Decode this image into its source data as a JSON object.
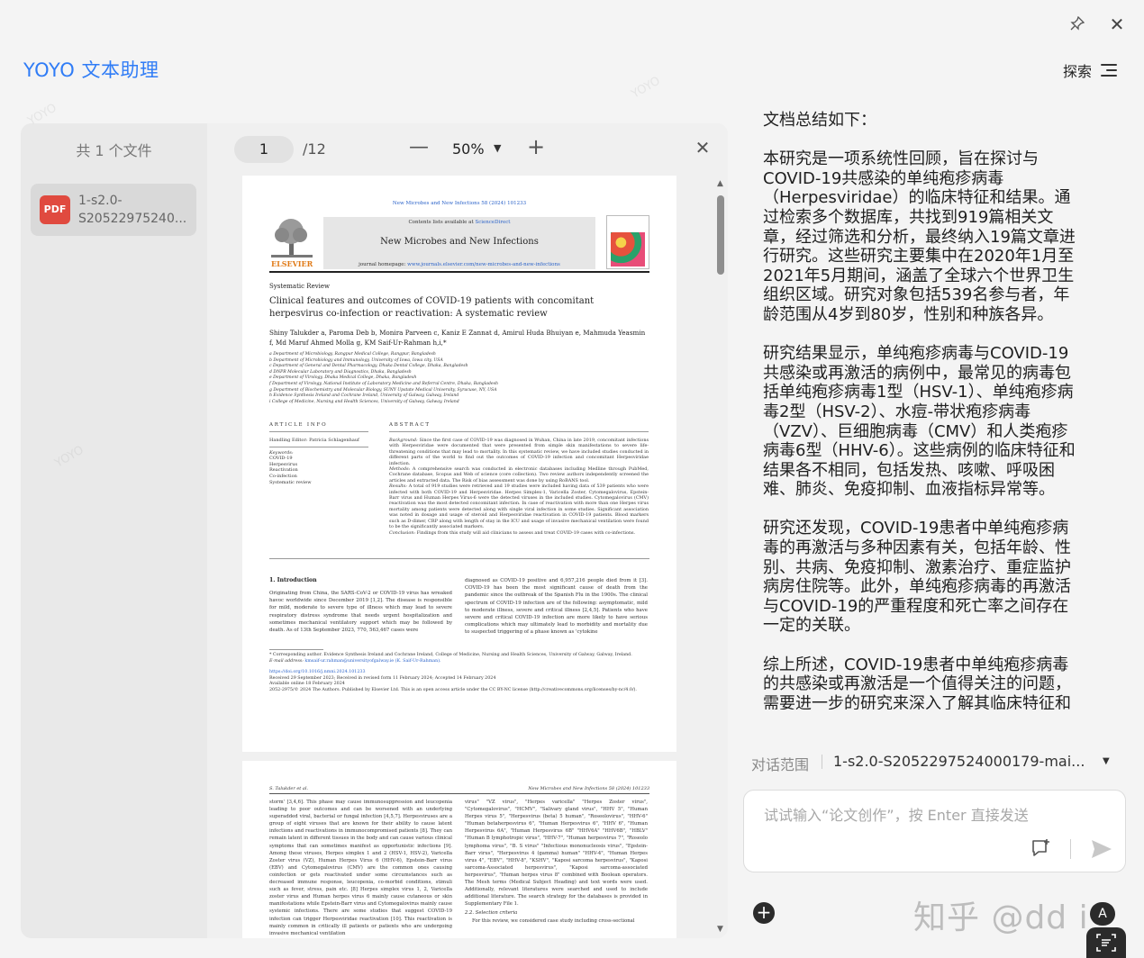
{
  "app": {
    "title": "YOYO 文本助理",
    "explore_label": "探索",
    "pin_icon": "pin-icon",
    "close_icon": "close-icon",
    "menu_icon": "menu-lines-icon"
  },
  "files": {
    "count_label": "共 1 个文件",
    "items": [
      {
        "type": "PDF",
        "name_line1": "1-s2.0-",
        "name_line2": "S20522975240..."
      }
    ]
  },
  "viewer": {
    "current_page": "1",
    "total_pages": "/12",
    "zoom_minus": "—",
    "zoom": "50%",
    "zoom_caret": "▼",
    "zoom_plus": "+",
    "close": "✕",
    "scroll_up": "▲",
    "scroll_down": "▼"
  },
  "paper": {
    "journal_top": "New Microbes and New Infections 58 (2024) 101233",
    "contents_prefix": "Contents lists available at ",
    "contents_link": "ScienceDirect",
    "journal_name": "New Microbes and New Infections",
    "homepage_prefix": "journal homepage: ",
    "homepage_link": "www.journals.elsevier.com/new-microbes-and-new-infections",
    "publisher": "ELSEVIER",
    "section_type": "Systematic Review",
    "title": "Clinical features and outcomes of COVID-19 patients with concomitant herpesvirus co-infection or reactivation: A systematic review",
    "authors": "Shiny Talukder a, Paroma Deb b, Monira Parveen c, Kaniz E Zannat d, Amirul Huda Bhuiyan e, Mahmuda Yeasmin f, Md Maruf Ahmed Molla g, KM Saif-Ur-Rahman h,i,*",
    "affiliations": [
      "a Department of Microbiology, Rangpur Medical College, Rangpur, Bangladesh",
      "b Department of Microbiology and Immunology, University of Iowa, Iowa city, USA",
      "c Department of General and Dental Pharmacology, Dhaka Dental College, Dhaka, Bangladesh",
      "d DNPR Molecular Laboratory and Diagnostics, Dhaka, Bangladesh",
      "e Department of Virology, Dhaka Medical College, Dhaka, Bangladesh",
      "f Department of Virology, National Institute of Laboratory Medicine and Referral Centre, Dhaka, Bangladesh",
      "g Department of Biochemistry and Molecular Biology, SUNY Upstate Medical University, Syracuse, NY, USA",
      "h Evidence Synthesis Ireland and Cochrane Ireland, University of Galway, Galway, Ireland",
      "i College of Medicine, Nursing and Health Sciences, University of Galway, Galway, Ireland"
    ],
    "article_info_head": "ARTICLE INFO",
    "abstract_head": "ABSTRACT",
    "handling_editor": "Handling Editor: Patricia Schlagenhauf",
    "keywords_label": "Keywords:",
    "keywords": [
      "COVID-19",
      "Herpesvirus",
      "Reactivation",
      "Co-infection",
      "Systematic review"
    ],
    "abstract_background_label": "Background:",
    "abstract_background": "Since the first case of COVID-19 was diagnosed in Wuhan, China in late 2019, concomitant infections with Herpesviridae were documented that were presented from simple skin manifestations to severe life-threatening conditions that may lead to mortality. In this systematic review, we have included studies conducted in different parts of the world to find out the outcomes of COVID-19 infection and concomitant Herpesviridae infection.",
    "abstract_methods_label": "Methods:",
    "abstract_methods": "A comprehensive search was conducted in electronic databases including Medline through PubMed, Cochrane database, Scopus and Web of science (core collection). Two review authors independently screened the articles and extracted data. The Risk of bias assessment was done by using RoBANS tool.",
    "abstract_results_label": "Results:",
    "abstract_results": "A total of 919 studies were retrieved and 19 studies were included having data of 539 patients who were infected with both COVID-19 and Herpesviridae. Herpes Simplex-1, Varicella Zoster, Cytomegalovirus, Epstein-Barr virus and Human Herpes Virus-6 were the detected viruses in the included studies. Cytomegalovirus (CMV) reactivation was the most detected concomitant infection. In case of reactivation with more than one Herpes virus mortality among patients were detected along with single viral infection in some studies. Significant association was noted in dosage and usage of steroid and Herpesviridae reactivation in COVID-19 patients. Blood markers such as D-dimer, CRP along with length of stay in the ICU and usage of invasive mechanical ventilation were found to be the significantly associated markers.",
    "abstract_conclusion_label": "Conclusion:",
    "abstract_conclusion": "Findings from this study will aid clinicians to assess and treat COVID-19 cases with co-infections.",
    "intro_head": "1. Introduction",
    "intro_col1": "Originating from China, the SARS-CoV-2 or COVID-19 virus has wreaked havoc worldwide since December 2019 [1,2]. The disease is responsible for mild, moderate to severe type of illness which may lead to severe respiratory distress syndrome that needs urgent hospitalization and sometimes mechanical ventilatory support which may be followed by death. As of 13th September 2023, 770, 563,467 cases were",
    "intro_col2": "diagnosed as COVID-19 positive and 6,957,216 people died from it [3]. COVID-19 has been the most significant cause of death from the pandemic since the outbreak of the Spanish Flu in the 1900s. The clinical spectrum of COVID-19 infection are of the following: asymptomatic, mild to moderate illness, severe and critical illness [2,4,5]. Patients who have severe and critical COVID-19 infection are more likely to have serious complications which may ultimately lead to morbidity and mortality due to suspected triggering of a phase known as 'cytokine",
    "footnote_corr": "* Corresponding author. Evidence Synthesis Ireland and Cochrane Ireland, College of Medicine, Nursing and Health Sciences, University of Galway, Galway, Ireland.",
    "footnote_email_label": "E-mail address:",
    "footnote_email": "kmsaif-ur.rahman@universityofgalway.ie (K. Saif-Ur-Rahman).",
    "doi": "https://doi.org/10.1016/j.nmni.2024.101233",
    "received": "Received 29 September 2023; Received in revised form 11 February 2024; Accepted 14 February 2024",
    "available": "Available online 18 February 2024",
    "license": "2052-2975/© 2024 The Authors. Published by Elsevier Ltd. This is an open access article under the CC BY-NC license (http://creativecommons.org/licenses/by-nc/4.0/).",
    "p2_author": "S. Talukder et al.",
    "p2_journal": "New Microbes and New Infections 58 (2024) 101233",
    "p2_col1": "storm' [3,4,6]. This phase may cause immunosuppression and leucopenia leading to poor outcomes and can be worsened with an underlying superadded viral, bacterial or fungal infection [4,5,7]. Herpesviruses are a group of eight viruses that are known for their ability to cause latent infections and reactivations in immunocompromised patients [8]. They can remain latent in different tissues in the body and can cause various clinical symptoms that can sometimes manifest as opportunistic infections [9]. Among these viruses, Herpes simplex 1 and 2 (HSV-1, HSV-2), Varicella Zoster virus (VZ), Human Herpes Virus 6 (HHV-6), Epstein-Barr virus (EBV) and Cytomegalovirus (CMV) are the common ones causing coinfection or gets reactivated under some circumstances such as decreased immune response, leucopenia, co-morbid conditions, stimuli such as fever, stress, pain etc. [8] Herpes simplex virus 1, 2, Varicella zoster virus and Human herpes virus 6 mainly cause cutaneous or skin manifestations while Epstein-Barr virus and Cytomegalovirus mainly cause systemic infections. There are some studies that suggest COVID-19 infection can trigger Herpesviridae reactivation [10]. This reactivation is mainly common in critically ill patients or patients who are undergoing invasive mechanical ventilation",
    "p2_col2": "virus\" \"VZ virus\", \"Herpes varicella\" \"Herpes Zoster virus\", \"Cytomegalovirus\", \"HCMV\", \"Salivary gland virus\", \"HHV 5\", \"Human Herpes virus 5\", \"Herpesvirus (beta) 5 human\", \"Roseolovirus\", \"HHV-6\" \"Human betaherpesvirus 6\", \"Human Herpesvirus 6\", \"HHV 6\", \"Human Herpesvirus 6A\", \"Human Herpesvirus 6B\" \"HHV6A\" \"HHV6B\", \"HBLV\" \"Human B lymphotropic virus\", \"HHV-7\", \"Human herpesvirus 7\", \"Roseolo lymphoma virus\", \"B. S virus\" \"Infectious mononucleosis virus\", \"Epstein-Barr virus\", \"Herpesvirus 4 (gamma) human\" \"HHV-4\", \"Human Herpes virus 4\", \"EBV\", \"HHV-8\", \"KSHV\", \"Kaposi sarcoma herpesvirus\", \"Kaposi sarcoma-Associated herpesvirus\", \"Kaposi sarcoma-associated herpesvirus\", \"Human herpes virus 8\" combined with Boolean operators. The Mesh terms (Medical Subject Heading) and text words were used. Additionally, relevant literatures were searched and used to include additional literature. The search strategy for the databases is provided in Supplementary File 1.",
    "p2_sub": "2.2. Selection criteria",
    "p2_sub_text": "For this review, we considered case study including cross-sectional"
  },
  "summary": {
    "heading": "文档总结如下：",
    "paragraphs": [
      "本研究是一项系统性回顾，旨在探讨与COVID-19共感染的单纯疱疹病毒（Herpesviridae）的临床特征和结果。通过检索多个数据库，共找到919篇相关文章，经过筛选和分析，最终纳入19篇文章进行研究。这些研究主要集中在2020年1月至2021年5月期间，涵盖了全球六个世界卫生组织区域。研究对象包括539名参与者，年龄范围从4岁到80岁，性别和种族各异。",
      "研究结果显示，单纯疱疹病毒与COVID-19共感染或再激活的病例中，最常见的病毒包括单纯疱疹病毒1型（HSV-1）、单纯疱疹病毒2型（HSV-2）、水痘-带状疱疹病毒（VZV）、巨细胞病毒（CMV）和人类疱疹病毒6型（HHV-6）。这些病例的临床特征和结果各不相同，包括发热、咳嗽、呼吸困难、肺炎、免疫抑制、血液指标异常等。",
      "研究还发现，COVID-19患者中单纯疱疹病毒的再激活与多种因素有关，包括年龄、性别、共病、免疫抑制、激素治疗、重症监护病房住院等。此外，单纯疱疹病毒的再激活与COVID-19的严重程度和死亡率之间存在一定的关联。",
      "综上所述，COVID-19患者中单纯疱疹病毒的共感染或再激活是一个值得关注的问题，需要进一步的研究来深入了解其临床特征和结果，"
    ]
  },
  "chat": {
    "scope_label": "对话范围",
    "scope_value": "1-s2.0-S2052297524000179-mai...",
    "scope_caret": "▼",
    "input_placeholder": "试试输入“论文创作”，按 Enter 直接发送",
    "add_label": "+",
    "watermark": "知乎 @dd i",
    "round_a": "A"
  },
  "colors": {
    "brand": "#2f7cf6",
    "pdf_badge": "#e04a3f",
    "link": "#2a62c9",
    "elsevier": "#e07a17"
  }
}
